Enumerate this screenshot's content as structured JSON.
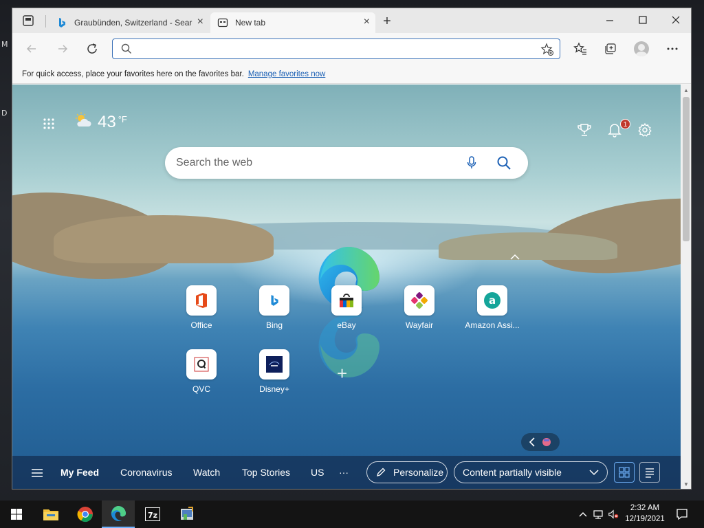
{
  "desktop": {
    "label_1": "M",
    "label_2": "D"
  },
  "browser": {
    "tabs": [
      {
        "title": "Graubünden, Switzerland - Searc",
        "active": false
      },
      {
        "title": "New tab",
        "active": true
      }
    ],
    "address": {
      "value": "",
      "placeholder": ""
    },
    "favorites_bar": {
      "message": "For quick access, place your favorites here on the favorites bar.",
      "link": "Manage favorites now"
    }
  },
  "newtab": {
    "weather": {
      "temp": "43",
      "unit": "°F",
      "icon": "partly-cloudy-icon"
    },
    "notification_count": "1",
    "search": {
      "placeholder": "Search the web"
    },
    "quick_links": [
      {
        "label": "Office"
      },
      {
        "label": "Bing"
      },
      {
        "label": "eBay"
      },
      {
        "label": "Wayfair"
      },
      {
        "label": "Amazon Assi..."
      },
      {
        "label": "QVC"
      },
      {
        "label": "Disney+"
      }
    ],
    "feed": {
      "tabs": [
        "My Feed",
        "Coronavirus",
        "Watch",
        "Top Stories",
        "US"
      ],
      "more": "···",
      "personalize": "Personalize",
      "visibility": "Content partially visible"
    }
  },
  "taskbar": {
    "time": "2:32 AM",
    "date": "12/19/2021"
  },
  "colors": {
    "accent": "#3c72b8",
    "feedbar": "#142d50",
    "badge": "#c0392b"
  }
}
